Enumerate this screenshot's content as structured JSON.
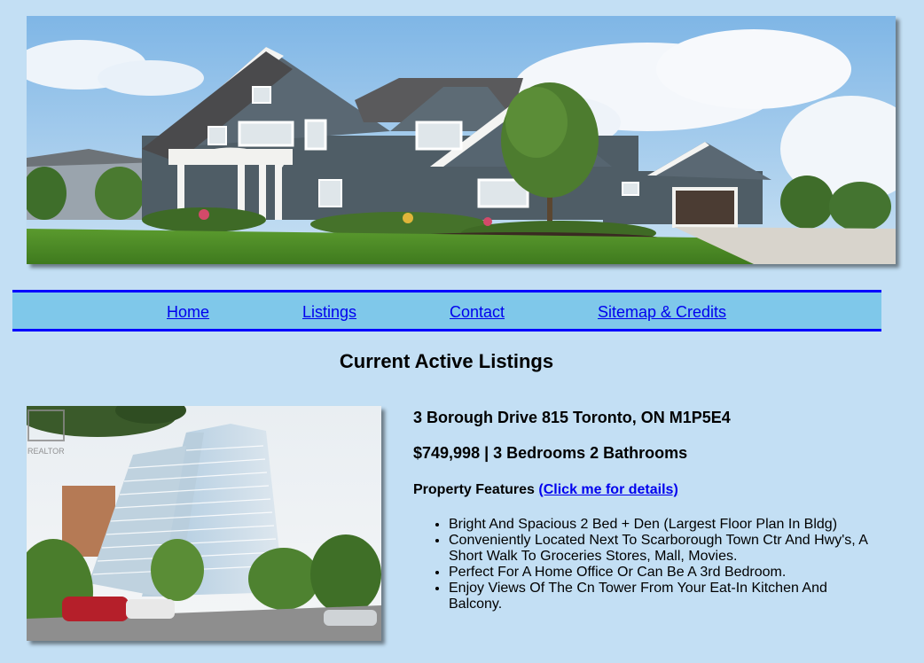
{
  "nav": {
    "items": [
      {
        "label": "Home"
      },
      {
        "label": "Listings"
      },
      {
        "label": "Contact"
      },
      {
        "label": "Sitemap & Credits"
      }
    ]
  },
  "page": {
    "heading": "Current Active Listings"
  },
  "listing": {
    "address": "3 Borough Drive 815 Toronto, ON M1P5E4",
    "summary": "$749,998 | 3 Bedrooms 2 Bathrooms",
    "features_label": "Property Features",
    "details_link": "(Click me for details)",
    "photo_watermark": "REALTOR",
    "features": [
      "Bright And Spacious 2 Bed + Den (Largest Floor Plan In Bldg)",
      "Conveniently Located Next To Scarborough Town Ctr And Hwy's, A Short Walk To Groceries Stores, Mall, Movies.",
      "Perfect For A Home Office Or Can Be A 3rd Bedroom.",
      "Enjoy Views Of The Cn Tower From Your Eat-In Kitchen And Balcony."
    ]
  },
  "colors": {
    "page_background": "#c3dff4",
    "nav_background": "#7fc8ea",
    "nav_border": "#0000ff",
    "link": "#0000ee"
  }
}
